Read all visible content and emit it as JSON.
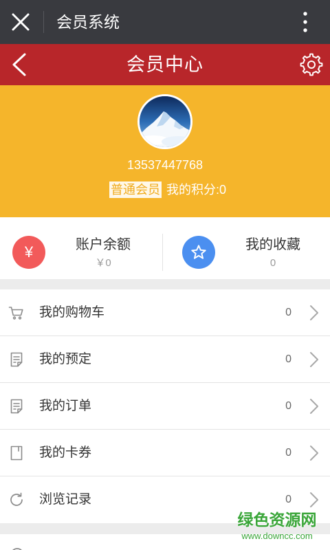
{
  "top_bar": {
    "title": "会员系统",
    "close_icon": "close-icon",
    "menu_icon": "more-vertical-icon",
    "background": "#393a3f"
  },
  "header": {
    "title": "会员中心",
    "back_icon": "chevron-left-icon",
    "settings_icon": "gear-icon",
    "background": "#b8262a"
  },
  "profile": {
    "background": "#f5b52b",
    "phone": "13537447768",
    "level_badge": "普通会员",
    "points": "我的积分:0"
  },
  "summary": [
    {
      "icon": "yen-icon",
      "icon_glyph": "¥",
      "icon_color": "#f25a5a",
      "label": "账户余额",
      "value": "￥0"
    },
    {
      "icon": "star-icon",
      "icon_color": "#4b8ff0",
      "label": "我的收藏",
      "value": "0"
    }
  ],
  "menu": [
    {
      "icon": "cart-icon",
      "label": "我的购物车",
      "count": "0"
    },
    {
      "icon": "document-icon",
      "label": "我的预定",
      "count": "0"
    },
    {
      "icon": "document-icon",
      "label": "我的订单",
      "count": "0"
    },
    {
      "icon": "card-icon",
      "label": "我的卡券",
      "count": "0"
    },
    {
      "icon": "refresh-icon",
      "label": "浏览记录",
      "count": "0"
    }
  ],
  "watermark": {
    "name": "绿色资源网",
    "site": "www.downcc.com",
    "color": "#3aa639"
  }
}
